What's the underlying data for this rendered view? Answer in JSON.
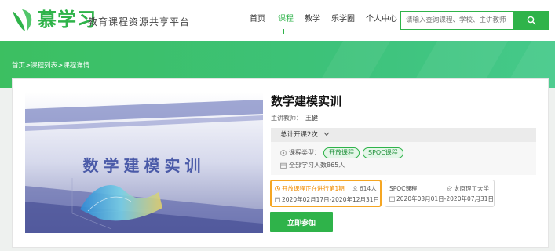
{
  "header": {
    "brand": "慕学习",
    "slogan": "教育课程资源共享平台",
    "nav": [
      {
        "label": "首页"
      },
      {
        "label": "课程"
      },
      {
        "label": "教学"
      },
      {
        "label": "乐学圈"
      },
      {
        "label": "个人中心"
      }
    ],
    "active_nav": "课程",
    "search": {
      "placeholder": "请输入查询课程、学校、主讲教师",
      "value": ""
    },
    "accent_color": "#2fb34a"
  },
  "breadcrumb": [
    "首页",
    "课程列表",
    "课程详情"
  ],
  "breadcrumb_separator": ">",
  "course": {
    "cover_title": "数学建模实训",
    "title": "数学建模实训",
    "teacher_label": "主讲教师：",
    "teacher": "王健",
    "open_count": "总计开课2次",
    "type_label": "课程类型：",
    "tags": [
      "开放课程",
      "SPOC课程"
    ],
    "learners": "全部学习人数865人",
    "join_label": "立即参加"
  },
  "sessions": [
    {
      "status": "开放课程正在进行第1期",
      "people": "614人",
      "dates": "2020年02月17日-2020年12月31日",
      "highlight_color": "#f5a623"
    },
    {
      "type": "SPOC课程",
      "school": "太原理工大学",
      "dates": "2020年03月01日-2020年07月31日"
    }
  ]
}
